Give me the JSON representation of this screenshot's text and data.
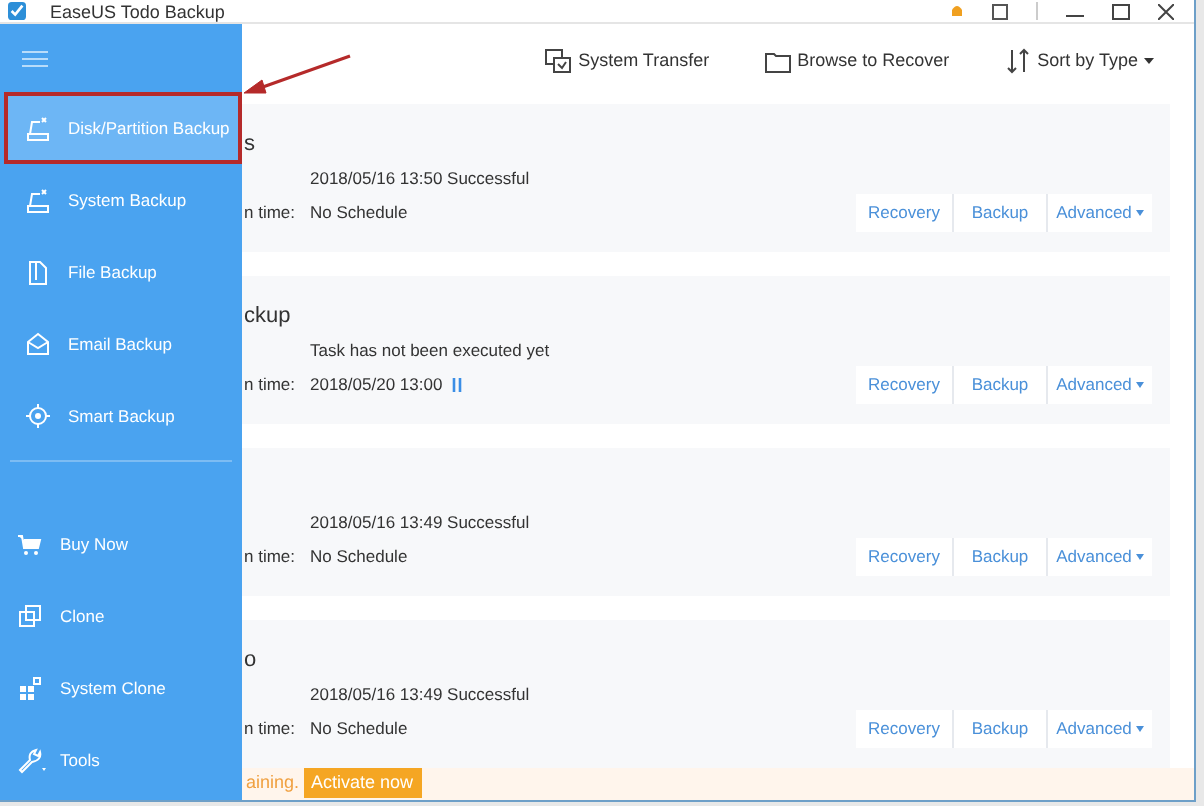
{
  "window": {
    "title": "EaseUS Todo Backup"
  },
  "toolbar": [
    {
      "kind": "transfer",
      "label": "System Transfer"
    },
    {
      "kind": "folder",
      "label": "Browse to Recover"
    },
    {
      "kind": "sort",
      "label": "Sort by Type"
    }
  ],
  "sidebar": {
    "items": [
      {
        "kind": "disk",
        "label": "Disk/Partition Backup",
        "selected": true,
        "highlighted": true
      },
      {
        "kind": "disk",
        "label": "System Backup",
        "selected": false,
        "highlighted": false
      },
      {
        "kind": "file",
        "label": "File Backup",
        "selected": false,
        "highlighted": false
      },
      {
        "kind": "mail",
        "label": "Email Backup",
        "selected": false,
        "highlighted": false
      },
      {
        "kind": "target",
        "label": "Smart Backup",
        "selected": false,
        "highlighted": false
      }
    ],
    "bottom_items": [
      {
        "kind": "cart",
        "label": "Buy Now"
      },
      {
        "kind": "clone",
        "label": "Clone"
      },
      {
        "kind": "blocks",
        "label": "System Clone"
      },
      {
        "kind": "wrench",
        "label": "Tools"
      }
    ]
  },
  "tasks": [
    {
      "title": "s",
      "status": "2018/05/16 13:50 Successful",
      "schedule_label": "n time:",
      "schedule": "No Schedule",
      "paused": false,
      "actions": [
        {
          "kind": "plain",
          "label": "Recovery"
        },
        {
          "kind": "plain",
          "label": "Backup"
        },
        {
          "kind": "dropdown",
          "label": "Advanced"
        }
      ]
    },
    {
      "title": "ckup",
      "status": "Task has not been executed yet",
      "schedule_label": "n time:",
      "schedule": "2018/05/20 13:00",
      "paused": true,
      "actions": [
        {
          "kind": "plain",
          "label": "Recovery"
        },
        {
          "kind": "plain",
          "label": "Backup"
        },
        {
          "kind": "dropdown",
          "label": "Advanced"
        }
      ]
    },
    {
      "status": "2018/05/16 13:49 Successful",
      "schedule_label": "n time:",
      "schedule": "No Schedule",
      "paused": false,
      "actions": [
        {
          "kind": "plain",
          "label": "Recovery"
        },
        {
          "kind": "plain",
          "label": "Backup"
        },
        {
          "kind": "dropdown",
          "label": "Advanced"
        }
      ]
    },
    {
      "title": "o",
      "status": "2018/05/16 13:49 Successful",
      "schedule_label": "n time:",
      "schedule": "No Schedule",
      "paused": false,
      "actions": [
        {
          "kind": "plain",
          "label": "Recovery"
        },
        {
          "kind": "plain",
          "label": "Backup"
        },
        {
          "kind": "dropdown",
          "label": "Advanced"
        }
      ]
    }
  ],
  "banner": {
    "text": "aining.",
    "button": "Activate now"
  }
}
